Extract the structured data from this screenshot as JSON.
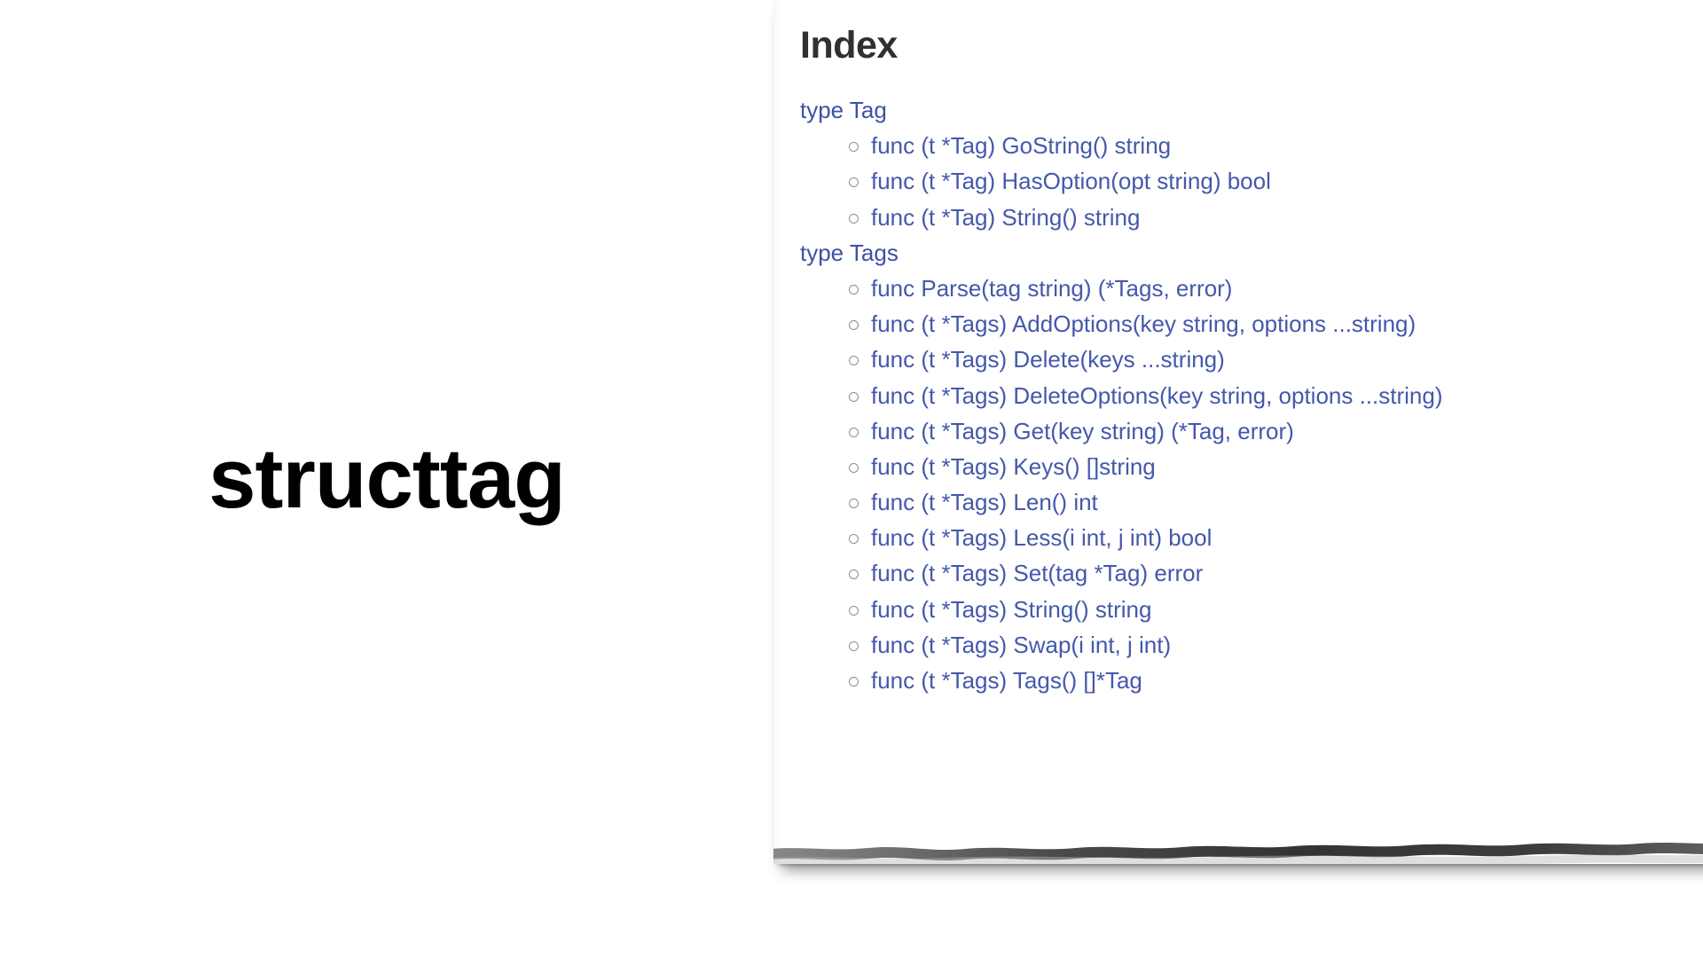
{
  "hero": {
    "title": "structtag"
  },
  "card": {
    "heading": "Index",
    "sections": [
      {
        "type_label": "type Tag",
        "funcs": [
          "func (t *Tag) GoString() string",
          "func (t *Tag) HasOption(opt string) bool",
          "func (t *Tag) String() string"
        ]
      },
      {
        "type_label": "type Tags",
        "funcs": [
          "func Parse(tag string) (*Tags, error)",
          "func (t *Tags) AddOptions(key string, options ...string)",
          "func (t *Tags) Delete(keys ...string)",
          "func (t *Tags) DeleteOptions(key string, options ...string)",
          "func (t *Tags) Get(key string) (*Tag, error)",
          "func (t *Tags) Keys() []string",
          "func (t *Tags) Len() int",
          "func (t *Tags) Less(i int, j int) bool",
          "func (t *Tags) Set(tag *Tag) error",
          "func (t *Tags) String() string",
          "func (t *Tags) Swap(i int, j int)",
          "func (t *Tags) Tags() []*Tag"
        ]
      }
    ]
  },
  "colors": {
    "link": "#4458ac",
    "heading": "#31302f",
    "hero_title": "#000000",
    "bullet": "#8d8d92",
    "background": "#ffffff"
  },
  "icons": {
    "bullet": "hollow-circle-bullet-icon"
  }
}
